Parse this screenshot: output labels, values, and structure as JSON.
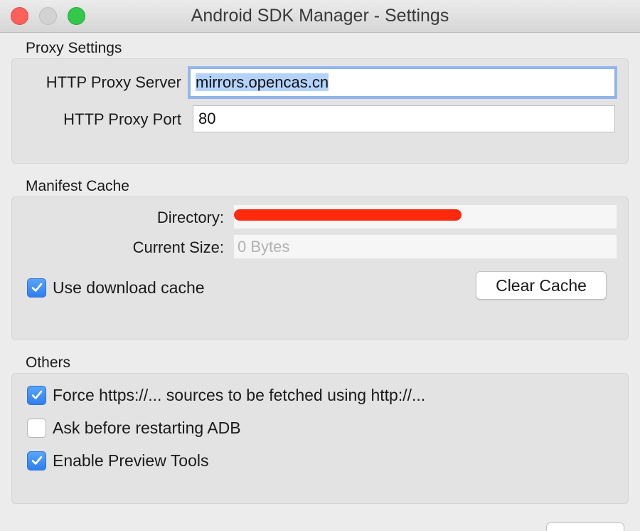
{
  "window": {
    "title": "Android SDK Manager - Settings"
  },
  "proxy": {
    "section_label": "Proxy Settings",
    "server_label": "HTTP Proxy Server",
    "server_value": "mirrors.opencas.cn",
    "port_label": "HTTP Proxy Port",
    "port_value": "80"
  },
  "manifest_cache": {
    "section_label": "Manifest Cache",
    "directory_label": "Directory:",
    "current_size_label": "Current Size:",
    "current_size_value": "0 Bytes",
    "use_download_cache": {
      "label": "Use download cache",
      "checked": true
    },
    "clear_cache_label": "Clear Cache"
  },
  "others": {
    "section_label": "Others",
    "options": [
      {
        "label": "Force https://... sources to be fetched using http://...",
        "checked": true
      },
      {
        "label": "Ask before restarting ADB",
        "checked": false
      },
      {
        "label": "Enable Preview Tools",
        "checked": true
      }
    ]
  },
  "colors": {
    "accent": "#2f7ff0",
    "focus_ring": "#93b7ec",
    "selection": "#b4d3fc",
    "redaction": "#ff2a0e"
  },
  "icons": {
    "close": "close-icon",
    "minimize": "minimize-icon",
    "zoom": "zoom-icon",
    "check": "checkmark-icon"
  }
}
